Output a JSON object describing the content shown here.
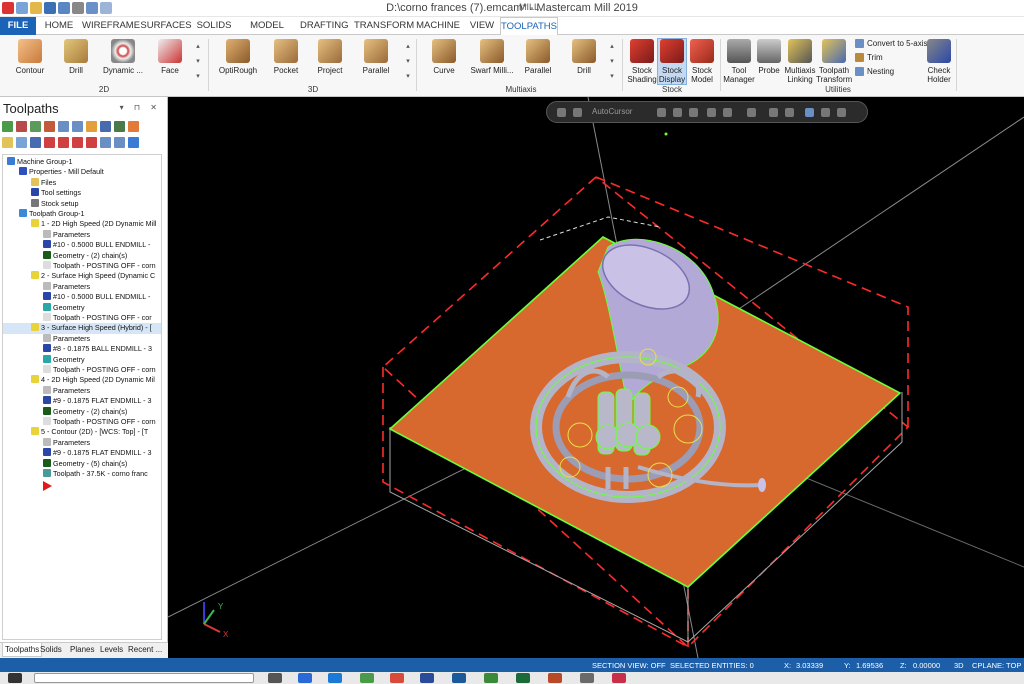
{
  "window": {
    "title": "D:\\corno frances (7).emcam* - Mastercam Mill 2019",
    "context_tab": "MILL"
  },
  "tabs": [
    "FILE",
    "HOME",
    "WIREFRAME",
    "SURFACES",
    "SOLIDS",
    "MODEL PREP",
    "DRAFTING",
    "TRANSFORM",
    "MACHINE",
    "VIEW",
    "TOOLPATHS"
  ],
  "active_tab": "TOOLPATHS",
  "ribbon": {
    "groups": {
      "g2d": "2D",
      "g3d": "3D",
      "multiaxis": "Multiaxis",
      "stock": "Stock",
      "utilities": "Utilities"
    },
    "buttons_2d": [
      "Contour",
      "Drill",
      "Dynamic ...",
      "Face"
    ],
    "buttons_3d": [
      "OptiRough",
      "Pocket",
      "Project",
      "Parallel"
    ],
    "buttons_multiaxis": [
      "Curve",
      "Swarf Milli...",
      "Parallel",
      "Drill"
    ],
    "stock": {
      "shading": [
        "Stock",
        "Shading"
      ],
      "display": [
        "Stock",
        "Display"
      ],
      "model": [
        "Stock",
        "Model"
      ]
    },
    "utilities": {
      "tool_manager": [
        "Tool",
        "Manager"
      ],
      "probe": "Probe",
      "multiaxis_linking": [
        "Multiaxis",
        "Linking"
      ],
      "toolpath_transform": [
        "Toolpath",
        "Transform"
      ],
      "convert": "Convert to 5-axis",
      "trim": "Trim",
      "nesting": "Nesting",
      "check_holder": [
        "Check",
        "Holder"
      ]
    }
  },
  "panel": {
    "title": "Toolpaths",
    "tree": [
      {
        "depth": 0,
        "text": "Machine Group-1",
        "icon": "#3a7bd5",
        "hl": false
      },
      {
        "depth": 1,
        "text": "Properties - Mill Default",
        "icon": "#2f4fbf",
        "hl": false
      },
      {
        "depth": 2,
        "text": "Files",
        "icon": "#e2c35a",
        "hl": false
      },
      {
        "depth": 2,
        "text": "Tool settings",
        "icon": "#2a47a8",
        "hl": false
      },
      {
        "depth": 2,
        "text": "Stock setup",
        "icon": "#777",
        "hl": false
      },
      {
        "depth": 1,
        "text": "Toolpath Group-1",
        "icon": "#3a8ad8",
        "hl": false
      },
      {
        "depth": 2,
        "text": "1 - 2D High Speed (2D Dynamic Mill",
        "icon": "#e8d43a",
        "hl": false
      },
      {
        "depth": 3,
        "text": "Parameters",
        "icon": "#bbb",
        "hl": false
      },
      {
        "depth": 3,
        "text": "#10 - 0.5000 BULL ENDMILL -",
        "icon": "#2a47a8",
        "hl": false
      },
      {
        "depth": 3,
        "text": "Geometry - (2) chain(s)",
        "icon": "#1a5a1a",
        "hl": false
      },
      {
        "depth": 3,
        "text": "Toolpath - POSTING OFF - corn",
        "icon": "#ddd",
        "hl": false
      },
      {
        "depth": 2,
        "text": "2 - Surface High Speed (Dynamic C",
        "icon": "#e8d43a",
        "hl": false
      },
      {
        "depth": 3,
        "text": "Parameters",
        "icon": "#bbb",
        "hl": false
      },
      {
        "depth": 3,
        "text": "#10 - 0.5000 BULL ENDMILL -",
        "icon": "#2a47a8",
        "hl": false
      },
      {
        "depth": 3,
        "text": "Geometry",
        "icon": "#2aa8a8",
        "hl": false
      },
      {
        "depth": 3,
        "text": "Toolpath - POSTING OFF - cor",
        "icon": "#ddd",
        "hl": false
      },
      {
        "depth": 2,
        "text": "3 - Surface High Speed (Hybrid) - [",
        "icon": "#e8d43a",
        "hl": true
      },
      {
        "depth": 3,
        "text": "Parameters",
        "icon": "#bbb",
        "hl": false
      },
      {
        "depth": 3,
        "text": "#8 - 0.1875 BALL ENDMILL - 3",
        "icon": "#2a47a8",
        "hl": false
      },
      {
        "depth": 3,
        "text": "Geometry",
        "icon": "#2aa8a8",
        "hl": false
      },
      {
        "depth": 3,
        "text": "Toolpath - POSTING OFF - corn",
        "icon": "#ddd",
        "hl": false
      },
      {
        "depth": 2,
        "text": "4 - 2D High Speed (2D Dynamic Mil",
        "icon": "#e8d43a",
        "hl": false
      },
      {
        "depth": 3,
        "text": "Parameters",
        "icon": "#bbb",
        "hl": false
      },
      {
        "depth": 3,
        "text": "#9 - 0.1875 FLAT ENDMILL - 3",
        "icon": "#2a47a8",
        "hl": false
      },
      {
        "depth": 3,
        "text": "Geometry - (2) chain(s)",
        "icon": "#1a5a1a",
        "hl": false
      },
      {
        "depth": 3,
        "text": "Toolpath - POSTING OFF - corn",
        "icon": "#ddd",
        "hl": false
      },
      {
        "depth": 2,
        "text": "5 - Contour (2D) - [WCS: Top] - [T",
        "icon": "#e8d43a",
        "hl": false
      },
      {
        "depth": 3,
        "text": "Parameters",
        "icon": "#bbb",
        "hl": false
      },
      {
        "depth": 3,
        "text": "#9 - 0.1875 FLAT ENDMILL - 3",
        "icon": "#2a47a8",
        "hl": false
      },
      {
        "depth": 3,
        "text": "Geometry - (5) chain(s)",
        "icon": "#1a5a1a",
        "hl": false
      },
      {
        "depth": 3,
        "text": "Toolpath - 37.5K - corno franc",
        "icon": "#4a9a9a",
        "hl": false
      }
    ],
    "bottom_tabs": [
      "Toolpaths",
      "Solids",
      "Planes",
      "Levels",
      "Recent ..."
    ]
  },
  "viewport": {
    "autocursor_label": "AutoCursor",
    "axis_x": "X",
    "axis_y": "Y"
  },
  "status": {
    "section_view": "SECTION VIEW: OFF",
    "selected": "SELECTED ENTITIES: 0",
    "x_label": "X:",
    "x_val": "3.03339",
    "y_label": "Y:",
    "y_val": "1.69536",
    "z_label": "Z:",
    "z_val": "0.00000",
    "mode": "3D",
    "cplane": "CPLANE: TOP"
  },
  "colors": {
    "file_tab": "#1b63b6",
    "stock_plate": "#d8692e",
    "status_bar": "#1d5ea8",
    "wire_red": "#ff2a2a",
    "edge_green": "#6aff3a"
  }
}
